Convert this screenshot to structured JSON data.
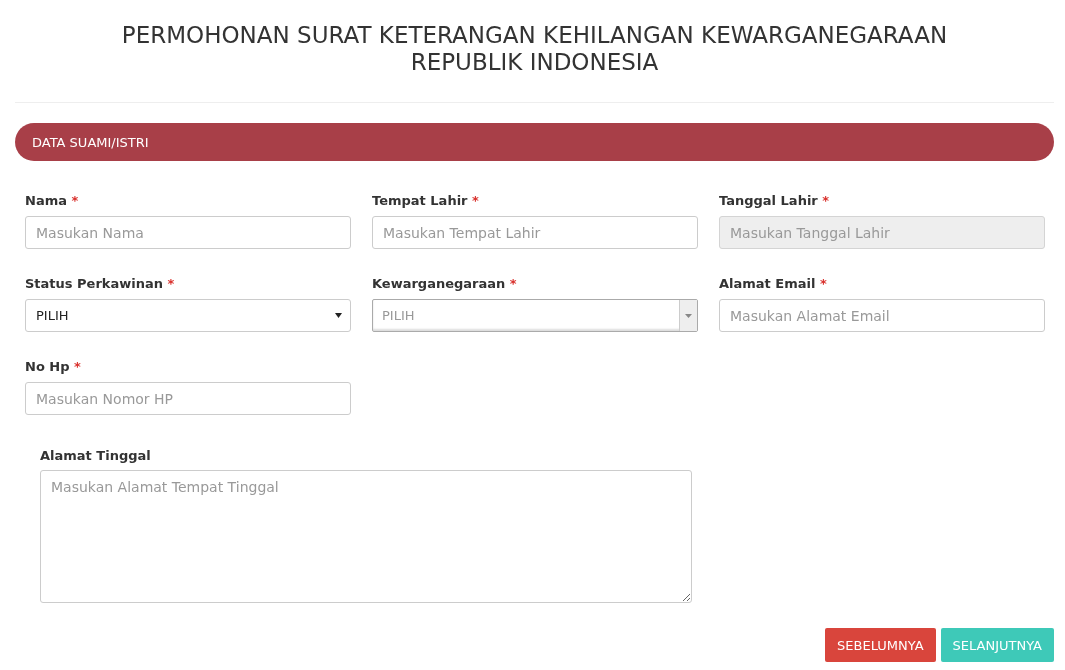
{
  "title_lines": [
    "PERMOHONAN SURAT KETERANGAN KEHILANGAN KEWARGANEGARAAN",
    "REPUBLIK INDONESIA"
  ],
  "section": {
    "title": "DATA SUAMI/ISTRI"
  },
  "required_mark": "*",
  "fields": [
    {
      "label": "Nama",
      "required": true,
      "kind": "text",
      "placeholder": "Masukan Nama",
      "disabled": false
    },
    {
      "label": "Tempat Lahir",
      "required": true,
      "kind": "text",
      "placeholder": "Masukan Tempat Lahir",
      "disabled": false
    },
    {
      "label": "Tanggal Lahir",
      "required": true,
      "kind": "text",
      "placeholder": "Masukan Tanggal Lahir",
      "disabled": true
    },
    {
      "label": "Status Perkawinan",
      "required": true,
      "kind": "select",
      "value": "PILIH",
      "disabled": false
    },
    {
      "label": "Kewarganegaraan",
      "required": true,
      "kind": "combo",
      "value": "PILIH",
      "disabled": false
    },
    {
      "label": "Alamat Email",
      "required": true,
      "kind": "text",
      "placeholder": "Masukan Alamat Email",
      "disabled": false
    },
    {
      "label": "No Hp",
      "required": true,
      "kind": "text",
      "placeholder": "Masukan Nomor HP",
      "disabled": false
    }
  ],
  "address": {
    "label": "Alamat Tinggal",
    "required": false,
    "placeholder": "Masukan Alamat Tempat Tinggal"
  },
  "buttons": [
    {
      "label": "SEBELUMNYA",
      "kind": "prev"
    },
    {
      "label": "SELANJUTNYA",
      "kind": "next"
    }
  ]
}
